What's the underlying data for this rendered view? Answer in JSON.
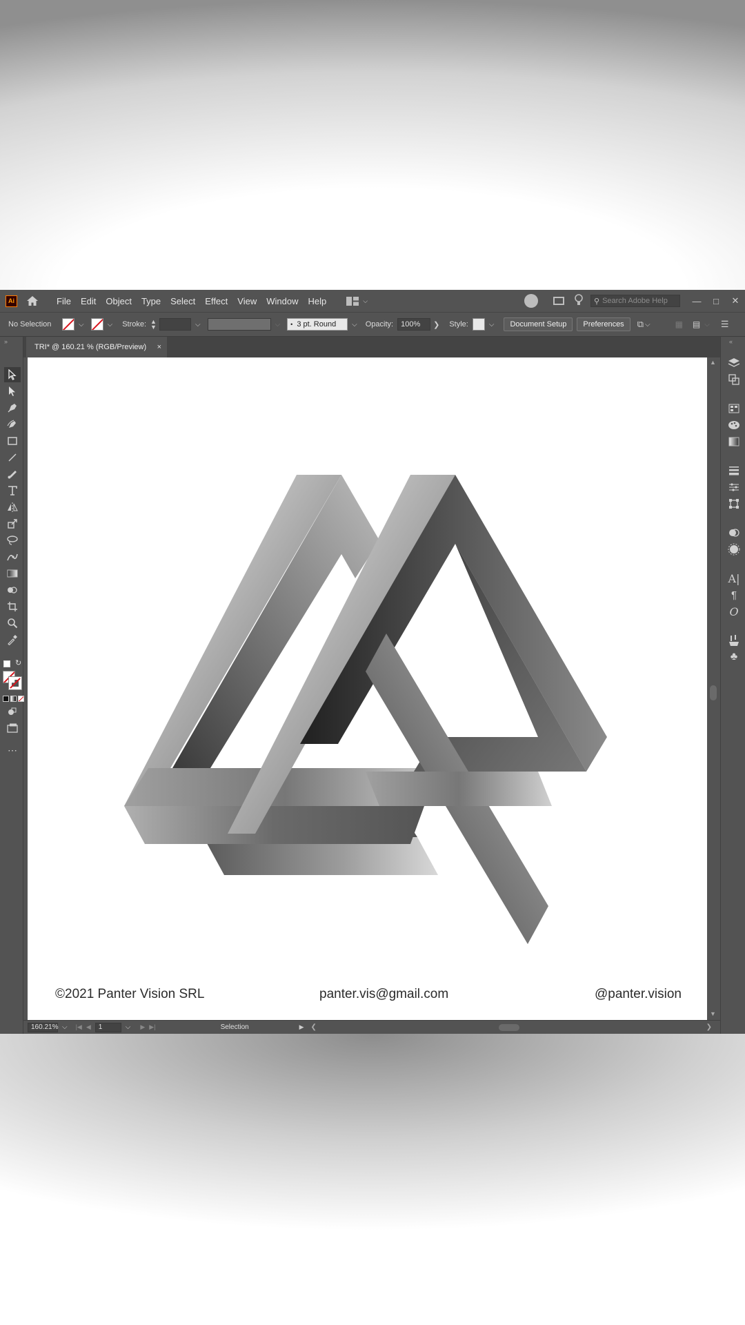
{
  "app": {
    "logo_text": "Ai",
    "menu": [
      "File",
      "Edit",
      "Object",
      "Type",
      "Select",
      "Effect",
      "View",
      "Window",
      "Help"
    ],
    "search_placeholder": "Search Adobe Help"
  },
  "control_bar": {
    "selection_label": "No Selection",
    "stroke_label": "Stroke:",
    "brush_label": "3 pt. Round",
    "opacity_label": "Opacity:",
    "opacity_value": "100%",
    "style_label": "Style:",
    "document_setup": "Document Setup",
    "preferences": "Preferences"
  },
  "tab": {
    "title": "TRI* @ 160.21 % (RGB/Preview)",
    "close": "×"
  },
  "artboard": {
    "copyright": "©2021 Panter Vision SRL",
    "email": "panter.vis@gmail.com",
    "handle": "@panter.vision"
  },
  "status_bar": {
    "zoom": "160.21%",
    "artboard_number": "1",
    "tool": "Selection"
  },
  "colors": {
    "ui_panel": "#535353",
    "ui_dark": "#444444",
    "canvas": "#ffffff",
    "stroke_none_red": "#d8141d"
  },
  "icons": {
    "left_tools": [
      "selection-tool-icon",
      "direct-selection-tool-icon",
      "pen-tool-icon",
      "curvature-tool-icon",
      "rectangle-tool-icon",
      "line-tool-icon",
      "paintbrush-tool-icon",
      "type-tool-icon",
      "reflect-tool-icon",
      "scale-tool-icon",
      "lasso-tool-icon",
      "puppet-warp-tool-icon",
      "gradient-tool-icon",
      "shape-builder-tool-icon",
      "artboard-tool-icon",
      "zoom-tool-icon",
      "eyedropper-tool-icon"
    ],
    "right_panels": [
      "layers-icon",
      "artboards-icon",
      "swatches-icon",
      "color-icon",
      "gradient-icon",
      "stroke-icon",
      "properties-icon",
      "transform-icon",
      "pathfinder-icon",
      "appearance-icon",
      "character-icon",
      "paragraph-icon",
      "opentype-icon",
      "brushes-icon",
      "symbols-icon"
    ]
  }
}
